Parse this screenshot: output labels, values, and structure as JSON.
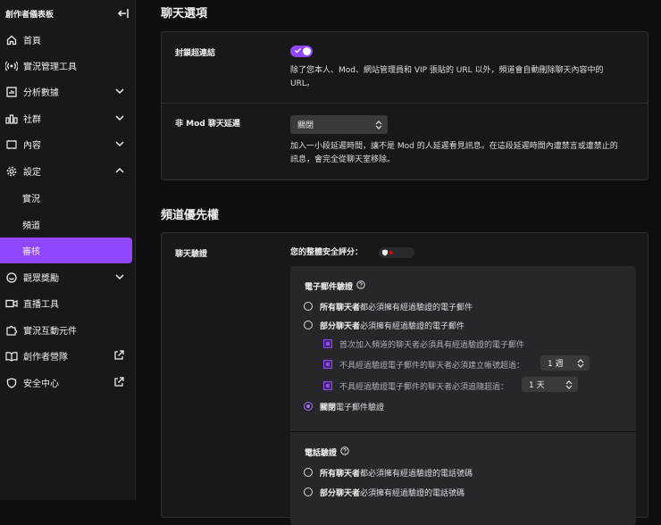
{
  "sidebar": {
    "title": "創作者儀表板",
    "items": [
      {
        "label": "首頁",
        "icon": "home-icon"
      },
      {
        "label": "實況管理工具",
        "icon": "broadcast-icon"
      },
      {
        "label": "分析數據",
        "icon": "analytics-icon"
      },
      {
        "label": "社群",
        "icon": "community-icon"
      },
      {
        "label": "內容",
        "icon": "content-icon"
      },
      {
        "label": "設定",
        "icon": "gear-icon"
      },
      {
        "label": "實況"
      },
      {
        "label": "頻道"
      },
      {
        "label": "審核"
      },
      {
        "label": "觀眾獎勵",
        "icon": "viewer-rewards-icon"
      },
      {
        "label": "直播工具",
        "icon": "camera-icon"
      },
      {
        "label": "實況互動元件",
        "icon": "extensions-icon"
      },
      {
        "label": "創作者營隊",
        "icon": "book-icon"
      },
      {
        "label": "安全中心",
        "icon": "shield-icon"
      }
    ]
  },
  "chat_options": {
    "title": "聊天選項",
    "block_links": {
      "label": "封鎖超連結",
      "enabled": true,
      "description_line1": "除了您本人、Mod、網站管理員和 VIP 張貼的 URL 以外，頻道會自動刪除聊天內容中的",
      "description_line2": "URL。"
    },
    "non_mod_delay": {
      "label": "非 Mod 聊天延遲",
      "value": "關閉",
      "description_line1": "加入一小段延遲時間，讓不是 Mod 的人延遲看見訊息。在這段延遲時間內遭禁言或遭禁止的",
      "description_line2": "訊息，會完全從聊天室移除。"
    }
  },
  "channel_priority": {
    "title": "頻道優先權",
    "chat_verification": {
      "label": "聊天驗證",
      "safety_score_label": "您的整體安全評分：",
      "safety_score_fraction": 0.1,
      "email": {
        "title": "電子郵件驗證",
        "all_bold": "所有聊天者",
        "all_rest": "都必須擁有經過驗證的電子郵件",
        "some_bold": "部分聊天者",
        "some_rest": "必須擁有經過驗證的電子郵件",
        "cb1": "首次加入頻道的聊天者必須具有經過驗證的電子郵件",
        "cb2": "不具經過驗證電子郵件的聊天者必須建立帳號超過：",
        "cb2_value": "1 週",
        "cb3": "不具經過驗證電子郵件的聊天者必須追隨超過：",
        "cb3_value": "1 天",
        "off_bold": "關閉",
        "off_rest": "電子郵件驗證"
      },
      "phone": {
        "title": "電話驗證",
        "all_bold": "所有聊天者",
        "all_rest": "都必須擁有經過驗證的電話號碼",
        "some_bold": "部分聊天者",
        "some_rest": "必須擁有經過驗證的電話號碼"
      }
    }
  },
  "colors": {
    "accent": "#9147ff",
    "danger": "#eb0400"
  }
}
